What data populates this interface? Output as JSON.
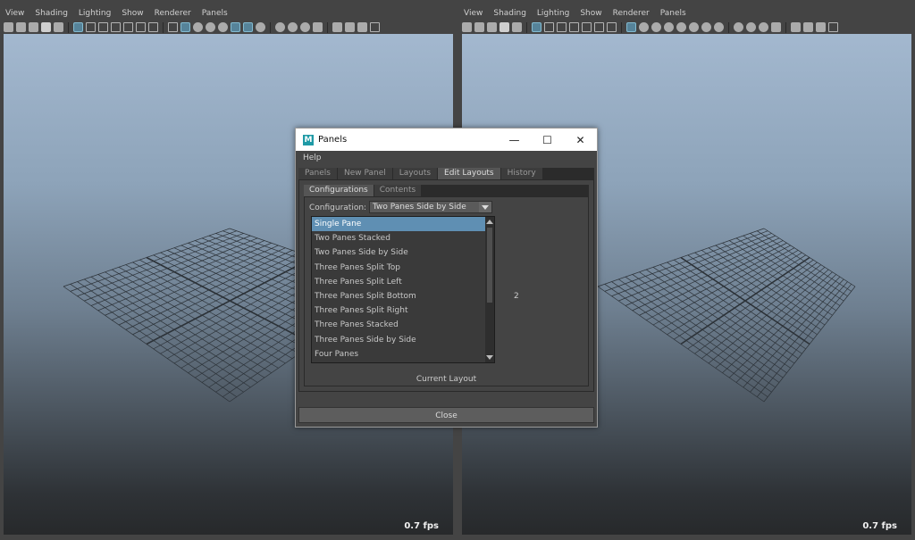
{
  "panes": [
    {
      "menu": [
        "View",
        "Shading",
        "Lighting",
        "Show",
        "Renderer",
        "Panels"
      ],
      "fps": "0.7 fps"
    },
    {
      "menu": [
        "View",
        "Shading",
        "Lighting",
        "Show",
        "Renderer",
        "Panels"
      ],
      "fps": "0.7 fps"
    }
  ],
  "dialog": {
    "title": "Panels",
    "logo": "M",
    "window_buttons": {
      "minimize": "—",
      "maximize": "☐",
      "close": "✕"
    },
    "menu": "Help",
    "tabs": [
      "Panels",
      "New Panel",
      "Layouts",
      "Edit Layouts",
      "History"
    ],
    "selected_tab": "Edit Layouts",
    "subtabs": [
      "Configurations",
      "Contents"
    ],
    "selected_subtab": "Configurations",
    "configuration_label": "Configuration:",
    "configuration_value": "Two Panes Side by Side",
    "options": [
      "Single Pane",
      "Two Panes Stacked",
      "Two Panes Side by Side",
      "Three Panes Split Top",
      "Three Panes Split Left",
      "Three Panes Split Bottom",
      "Three Panes Split Right",
      "Three Panes Stacked",
      "Three Panes Side by Side",
      "Four Panes"
    ],
    "highlighted_option": "Single Pane",
    "pane_count": "2",
    "current_layout_label": "Current Layout",
    "close_label": "Close"
  },
  "colors": {
    "highlight": "#5f8fb3",
    "active_tool": "#5a8fa8",
    "maya_logo": "#1f9aa6"
  }
}
